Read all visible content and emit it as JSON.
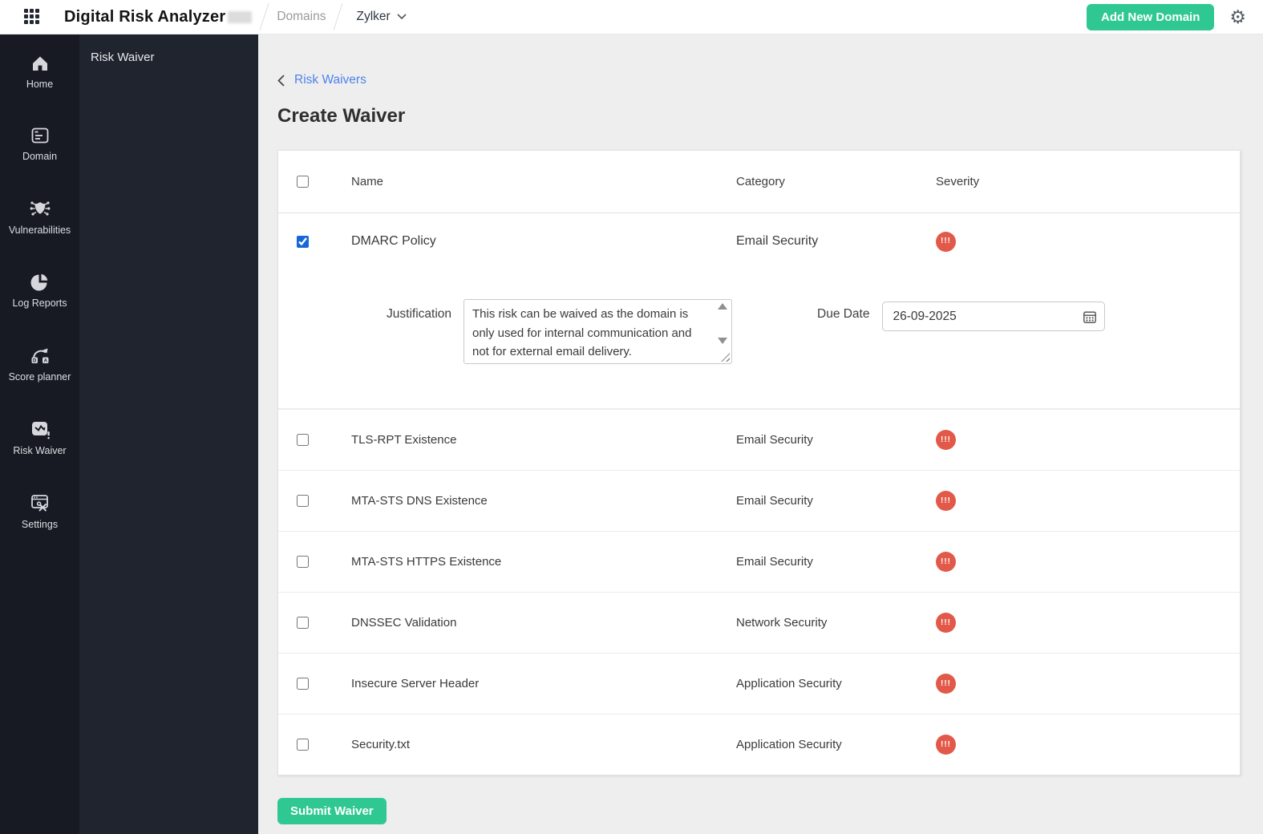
{
  "topbar": {
    "brand": "Digital Risk Analyzer",
    "breadcrumb": {
      "section": "Domains",
      "domain": "Zylker"
    },
    "add_domain_button": "Add New Domain"
  },
  "sidebar": {
    "items": [
      {
        "label": "Home"
      },
      {
        "label": "Domain"
      },
      {
        "label": "Vulnerabilities"
      },
      {
        "label": "Log Reports"
      },
      {
        "label": "Score planner"
      },
      {
        "label": "Risk Waiver"
      },
      {
        "label": "Settings"
      }
    ]
  },
  "panel": {
    "title": "Risk Waiver"
  },
  "main": {
    "back_link": "Risk Waivers",
    "page_title": "Create Waiver",
    "table": {
      "columns": {
        "name": "Name",
        "category": "Category",
        "severity": "Severity"
      },
      "rows": [
        {
          "name": "DMARC Policy",
          "category": "Email Security",
          "severity": "critical",
          "checked": true
        },
        {
          "name": "TLS-RPT Existence",
          "category": "Email Security",
          "severity": "critical",
          "checked": false
        },
        {
          "name": "MTA-STS DNS Existence",
          "category": "Email Security",
          "severity": "critical",
          "checked": false
        },
        {
          "name": "MTA-STS HTTPS Existence",
          "category": "Email Security",
          "severity": "critical",
          "checked": false
        },
        {
          "name": "DNSSEC Validation",
          "category": "Network Security",
          "severity": "critical",
          "checked": false
        },
        {
          "name": "Insecure Server Header",
          "category": "Application Security",
          "severity": "critical",
          "checked": false
        },
        {
          "name": "Security.txt",
          "category": "Application Security",
          "severity": "critical",
          "checked": false
        }
      ]
    },
    "waiver_form": {
      "justification_label": "Justification",
      "justification_value": "This risk can be waived as the domain is only used for internal communication and not for external email delivery.",
      "due_date_label": "Due Date",
      "due_date_value": "26-09-2025"
    },
    "submit_button": "Submit Waiver"
  },
  "icons": {
    "severity_glyph": "!!!",
    "gear_glyph": "⚙"
  },
  "colors": {
    "accent_green": "#2fc893",
    "severity_red": "#e2594a",
    "link_blue": "#4d82ec",
    "rail_bg": "#171a22",
    "panel_bg": "#20242f"
  }
}
